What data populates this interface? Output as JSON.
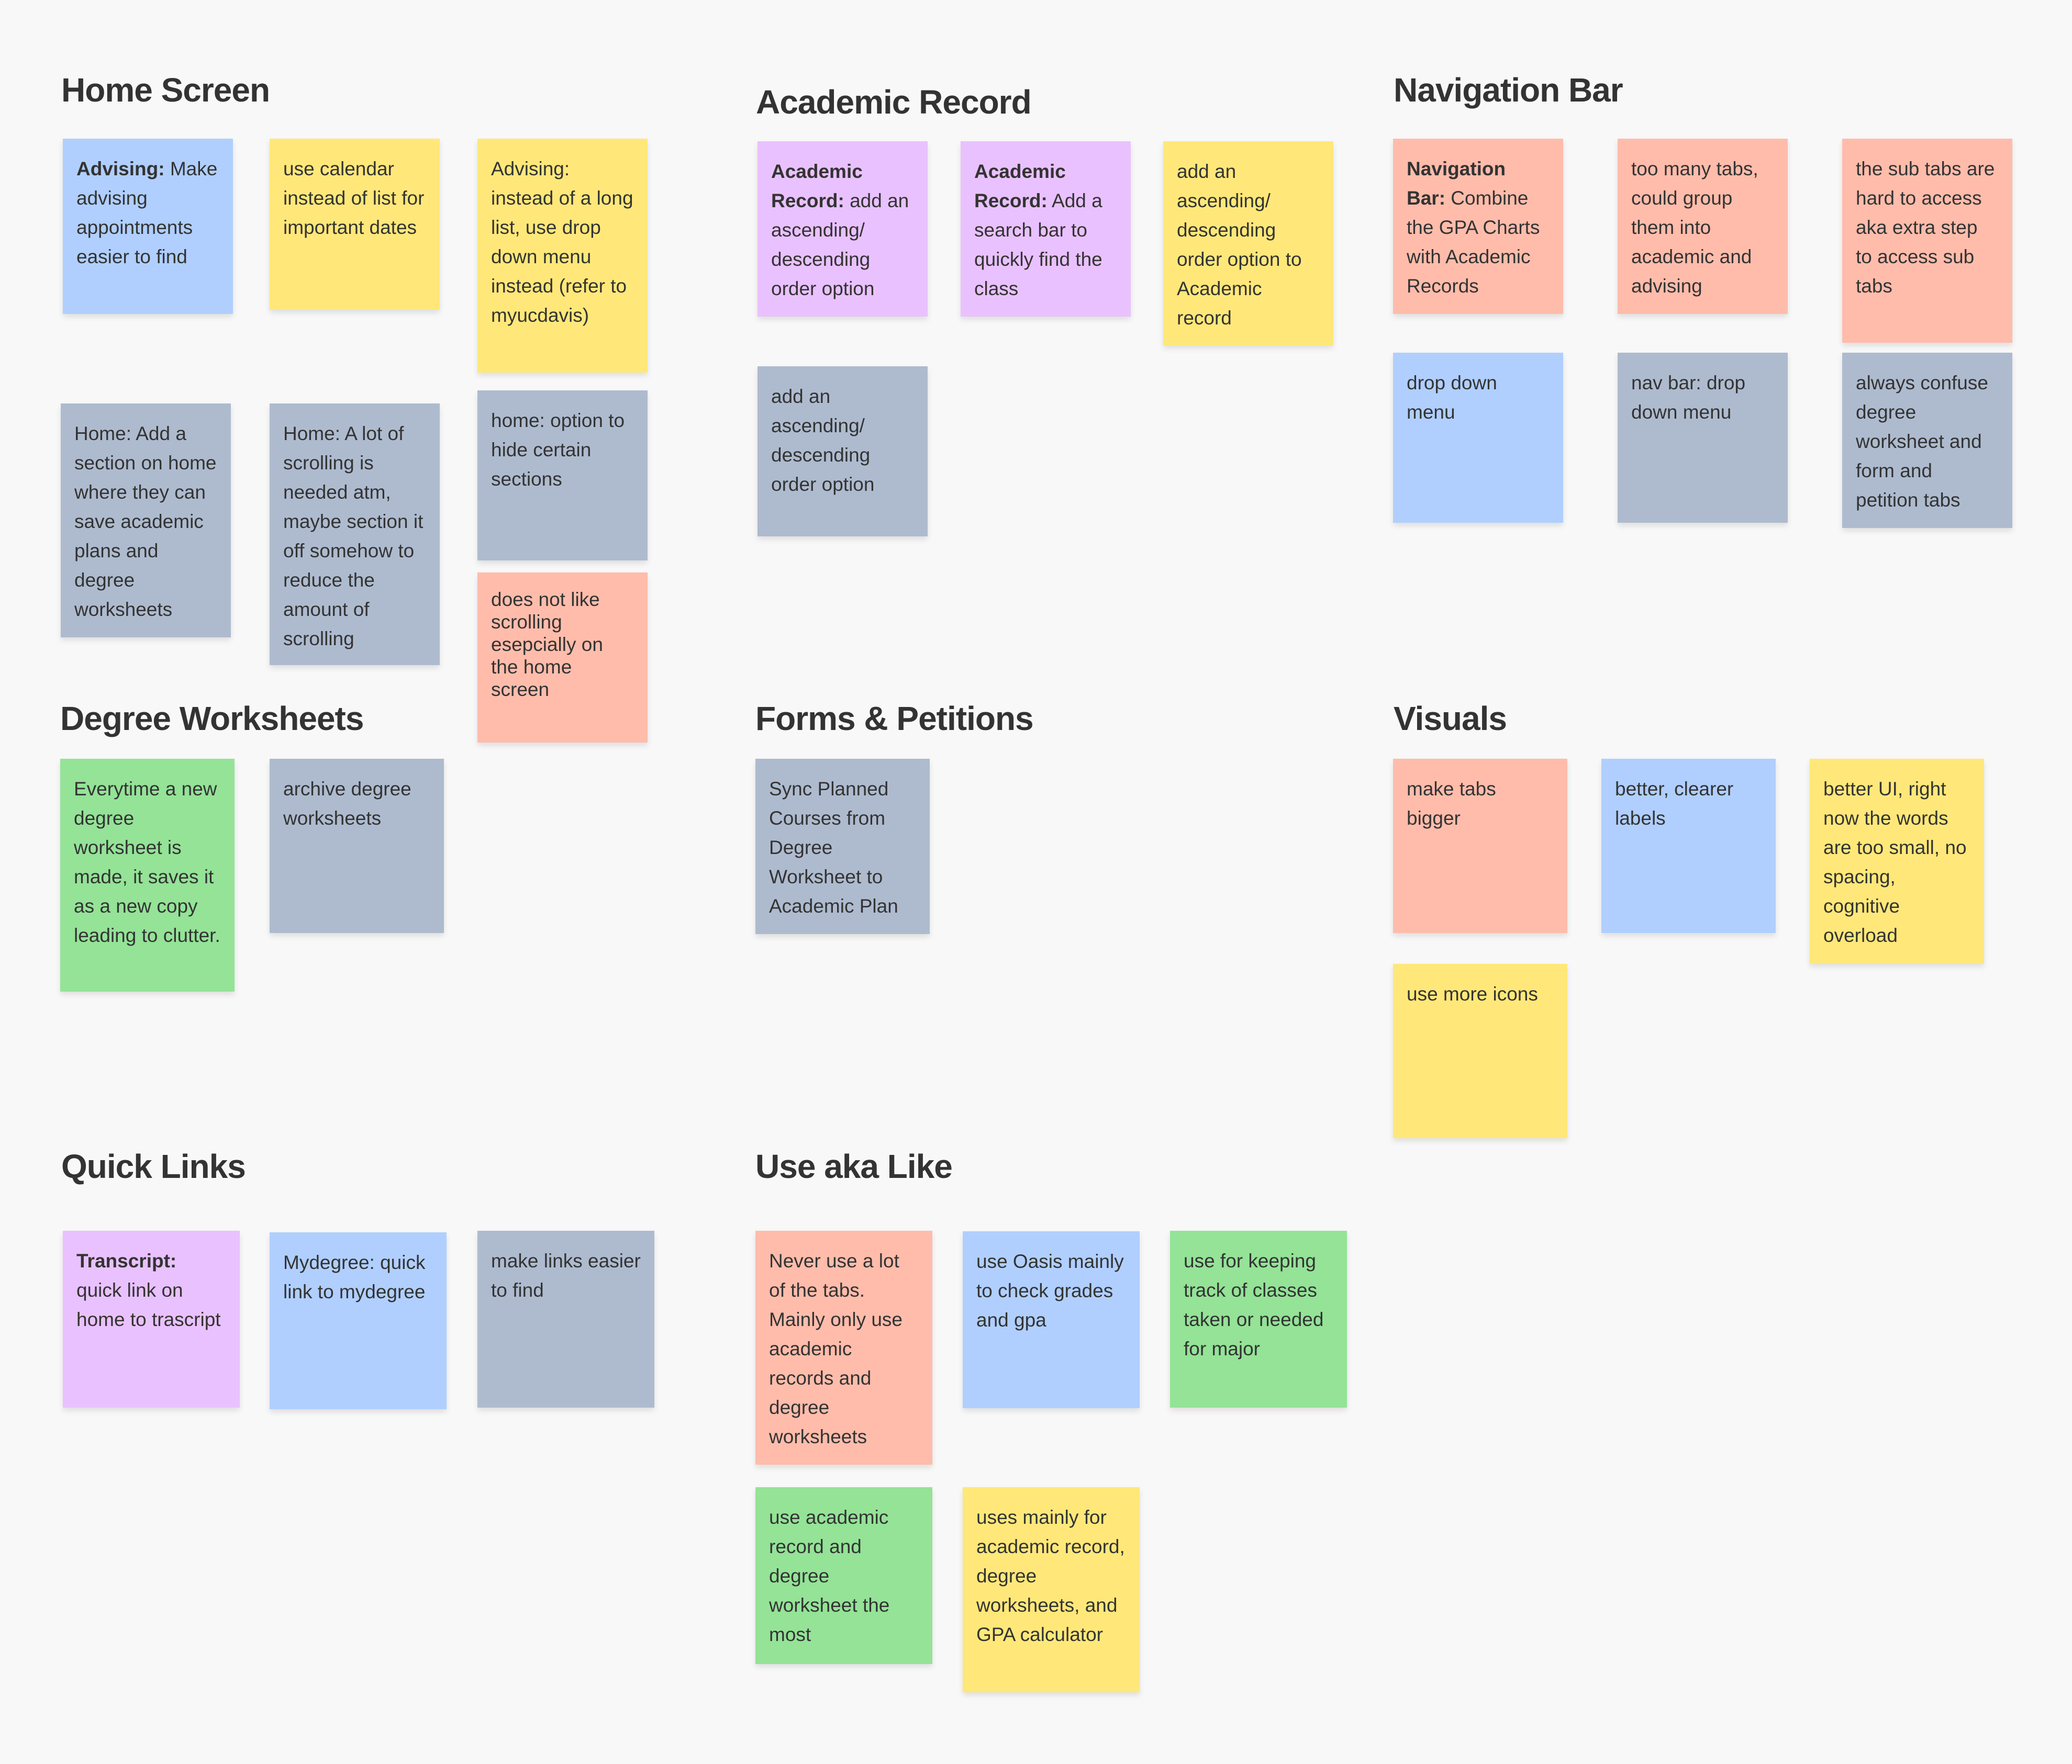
{
  "board": {
    "sections": {
      "home_screen": {
        "title": "Home Screen",
        "notes": [
          {
            "bold": "Advising:",
            "text": " Make advising appointments easier to find",
            "color": "blue"
          },
          {
            "bold": "",
            "text": "use calendar instead of list for important dates",
            "color": "yellow"
          },
          {
            "bold": "",
            "text": "Advising: instead of a long list, use drop down menu instead (refer to myucdavis)",
            "color": "yellow"
          },
          {
            "bold": "",
            "text": "Home: Add a section on home  where they can save academic plans and degree worksheets",
            "color": "gray"
          },
          {
            "bold": "",
            "text": "Home: A lot of scrolling is needed atm, maybe section it off somehow to reduce the amount of scrolling",
            "color": "gray"
          },
          {
            "bold": "",
            "text": "home: option to hide certain sections",
            "color": "gray"
          },
          {
            "bold": "",
            "text": "does not like scrolling esepcially on the home screen",
            "color": "salmon"
          }
        ]
      },
      "academic_record": {
        "title": "Academic Record",
        "notes": [
          {
            "bold": "Academic Record:",
            "text": " add an ascending/ descending order option",
            "color": "purple"
          },
          {
            "bold": "Academic Record:",
            "text": " Add a search bar to quickly find the class",
            "color": "purple"
          },
          {
            "bold": "",
            "text": "add an ascending/ descending order option to Academic record",
            "color": "yellow"
          },
          {
            "bold": "",
            "text": "add an ascending/ descending order option",
            "color": "gray"
          }
        ]
      },
      "navigation_bar": {
        "title": "Navigation Bar",
        "notes": [
          {
            "bold": "Navigation Bar:",
            "text": " Combine the GPA Charts with Academic Records",
            "color": "salmon"
          },
          {
            "bold": "",
            "text": "too many tabs, could group them into academic and advising",
            "color": "salmon"
          },
          {
            "bold": "",
            "text": "the sub tabs are hard to access aka extra step to access sub tabs",
            "color": "salmon"
          },
          {
            "bold": "",
            "text": "drop down menu",
            "color": "blue"
          },
          {
            "bold": "",
            "text": "nav bar: drop down menu",
            "color": "gray"
          },
          {
            "bold": "",
            "text": "always confuse degree worksheet and form and petition tabs",
            "color": "gray"
          }
        ]
      },
      "degree_worksheets": {
        "title": "Degree Worksheets",
        "notes": [
          {
            "bold": "",
            "text": "Everytime a new degree worksheet is made, it saves it as a new copy leading to clutter.",
            "color": "green"
          },
          {
            "bold": "",
            "text": "archive degree worksheets",
            "color": "gray"
          }
        ]
      },
      "forms_petitions": {
        "title": "Forms & Petitions",
        "notes": [
          {
            "bold": "",
            "text": "Sync Planned Courses from Degree Worksheet to Academic Plan",
            "color": "gray"
          }
        ]
      },
      "visuals": {
        "title": "Visuals",
        "notes": [
          {
            "bold": "",
            "text": "make tabs bigger",
            "color": "salmon"
          },
          {
            "bold": "",
            "text": "better, clearer labels",
            "color": "blue"
          },
          {
            "bold": "",
            "text": "better UI, right now the words are too small, no spacing, cognitive overload",
            "color": "yellow"
          },
          {
            "bold": "",
            "text": "use more icons",
            "color": "yellow"
          }
        ]
      },
      "quick_links": {
        "title": "Quick Links",
        "notes": [
          {
            "bold": "Transcript:",
            "text": " quick link on home to trascript",
            "color": "purple"
          },
          {
            "bold": "",
            "text": "Mydegree: quick link to mydegree",
            "color": "blue"
          },
          {
            "bold": "",
            "text": "make links easier to find",
            "color": "gray"
          }
        ]
      },
      "use_aka_like": {
        "title": "Use aka Like",
        "notes": [
          {
            "bold": "",
            "text": "Never use a lot of the tabs. Mainly only use academic records and degree worksheets",
            "color": "salmon"
          },
          {
            "bold": "",
            "text": "use Oasis mainly to check grades and gpa",
            "color": "blue"
          },
          {
            "bold": "",
            "text": "use for keeping track of classes taken or needed for major",
            "color": "green"
          },
          {
            "bold": "",
            "text": "use academic record and degree worksheet the most",
            "color": "green"
          },
          {
            "bold": "",
            "text": "uses mainly for academic record, degree worksheets, and GPA calculator",
            "color": "yellow"
          }
        ]
      }
    },
    "colors": {
      "background": "#f8f8f8",
      "blue": "#b0cffe",
      "yellow": "#ffe879",
      "gray": "#aebbcf",
      "salmon": "#ffbcab",
      "purple": "#e9c1fe",
      "green": "#94e397",
      "text": "#333333"
    }
  }
}
